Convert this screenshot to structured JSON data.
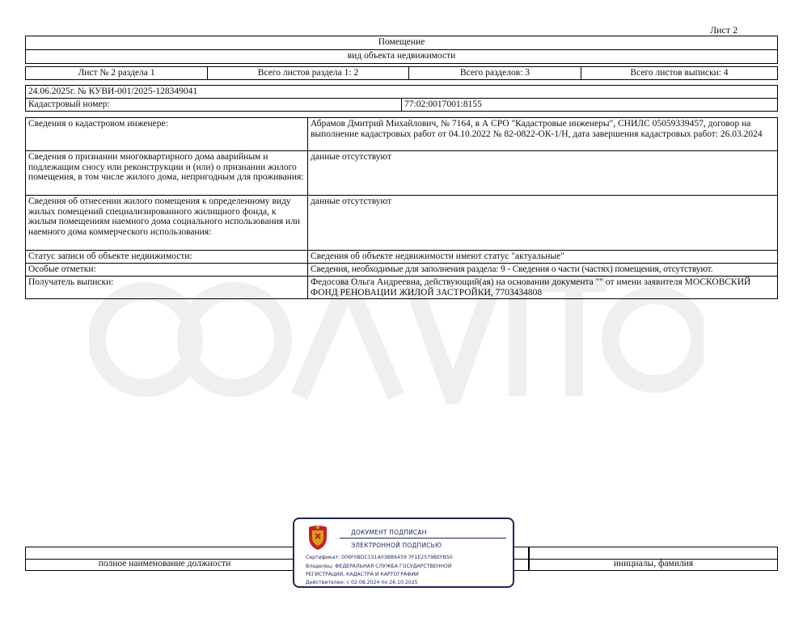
{
  "sheet_number": "Лист 2",
  "header": {
    "object_name": "Помещение",
    "object_type_caption": "вид объекта недвижимости"
  },
  "sheets_row": [
    "Лист № 2 раздела 1",
    "Всего листов раздела 1: 2",
    "Всего разделов: 3",
    "Всего листов выписки: 4"
  ],
  "document": {
    "date_number": "24.06.2025г. № КУВИ-001/2025-128349041",
    "cadastral_label": "Кадастровый номер:",
    "cadastral_number": "77:02:0017001:8155"
  },
  "info_rows": [
    {
      "label": "Сведения о кадастровом инженере:",
      "value": "Абрамов Дмитрий Михайлович, № 7164, в А СРО \"Кадастровые инженеры\", СНИЛС 05059339457, договор на выполнение кадастровых работ от 04.10.2022 № 82-0822-ОК-1/Н, дата завершения кадастровых работ: 26.03.2024"
    },
    {
      "label": "Сведения о признании многоквартирного дома аварийным и подлежащим сносу или реконструкции и (или) о признании жилого помещения, в том числе жилого дома, непригодным для проживания:",
      "value": "данные отсутствуют"
    },
    {
      "label": "Сведения об отнесении жилого помещения к определенному виду жилых помещений специализированного жилищного фонда, к жилым помещениям наемного дома социального использования или наемного дома коммерческого использования:",
      "value": "данные отсутствуют"
    },
    {
      "label": "Статус записи об объекте недвижимости:",
      "value": "Сведения об объекте недвижимости имеют статус \"актуальные\""
    },
    {
      "label": "Особые отметки:",
      "value": "Сведения, необходимые для заполнения раздела: 9 - Сведения о части (частях) помещения, отсутствуют."
    },
    {
      "label": "Получатель выписки:",
      "value": "Федосова Ольга Андреевна, действующий(ая) на основании документа \"\" от имени заявителя МОСКОВСКИЙ ФОНД РЕНОВАЦИИ ЖИЛОЙ ЗАСТРОЙКИ, 7703434808"
    }
  ],
  "signature": {
    "position_caption": "полное наименование должности",
    "initials_caption": "инициалы, фамилия"
  },
  "stamp": {
    "line1": "ДОКУМЕНТ ПОДПИСАН",
    "line2": "ЭЛЕКТРОННОЙ ПОДПИСЬЮ",
    "certificate": "Сертификат: 009F0BDC1S1A03BB6459 7F1E2579BEFB50",
    "owner_1": "Владелец: ФЕДЕРАЛЬНАЯ СЛУЖБА ГОСУДАРСТВЕННОЙ",
    "owner_2": "РЕГИСТРАЦИИ, КАДАСТРА И КАРТОГРАФИИ",
    "valid": "Действителен: с 02.08.2024 по 26.10.2025"
  },
  "colors": {
    "stamp": "#1f2559",
    "emblem_red": "#c8202a",
    "emblem_gold": "#d4a017"
  }
}
